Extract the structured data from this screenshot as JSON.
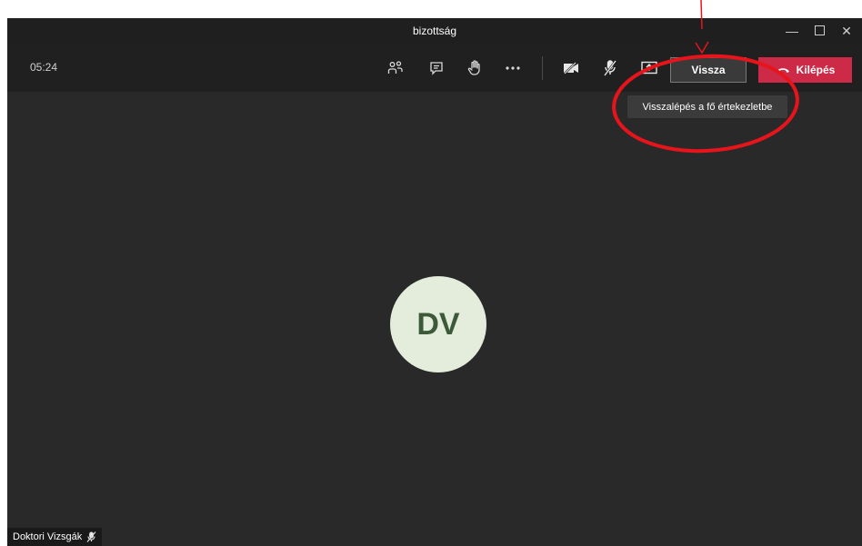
{
  "window": {
    "title": "bizottság"
  },
  "toolbar": {
    "timer": "05:24",
    "icons": [
      "participants-icon",
      "chat-icon",
      "raise-hand-icon",
      "more-icon",
      "camera-off-icon",
      "mic-off-icon",
      "share-screen-icon"
    ],
    "back_label": "Vissza",
    "leave_label": "Kilépés"
  },
  "tooltip": {
    "text": "Visszalépés a fő értekezletbe"
  },
  "participant": {
    "initials": "DV",
    "name": "Doktori Vizsgák"
  },
  "colors": {
    "background": "#292929",
    "toolbar": "#202020",
    "leave_button": "#cc2a47",
    "avatar_bg": "#e4ecdc",
    "avatar_text": "#3c5a3a",
    "annotation": "#e8141c"
  }
}
